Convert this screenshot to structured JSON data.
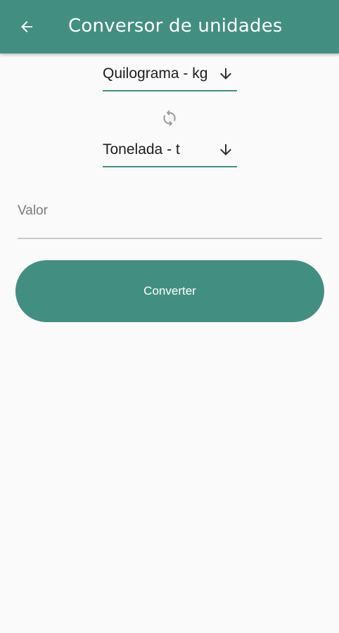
{
  "appbar": {
    "title": "Conversor de unidades",
    "back_icon": "arrow-left-icon",
    "color": "#428f82"
  },
  "from_unit": {
    "selected": "Quilograma - kg",
    "icon": "arrow-down-icon"
  },
  "swap": {
    "icon": "swap-refresh-icon"
  },
  "to_unit": {
    "selected": "Tonelada - t",
    "icon": "arrow-down-icon"
  },
  "value_input": {
    "placeholder": "Valor",
    "value": ""
  },
  "convert_button": {
    "label": "Converter"
  }
}
